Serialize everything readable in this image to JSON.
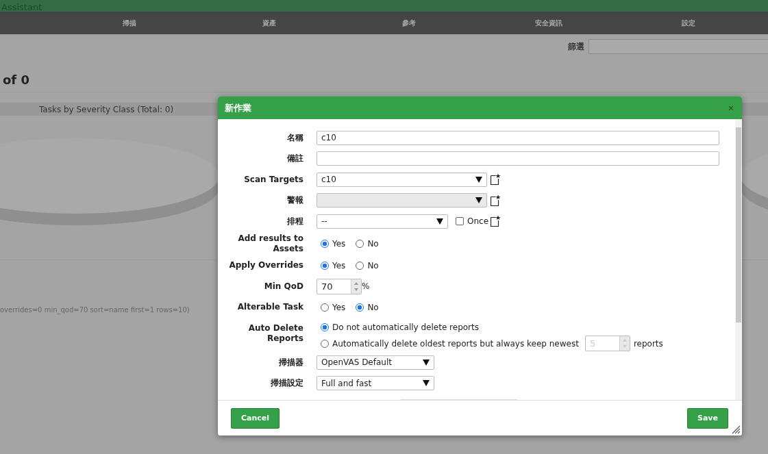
{
  "app": {
    "title": "Assistant"
  },
  "nav": [
    "掃描",
    "資產",
    "參考",
    "安全資訊",
    "設定"
  ],
  "filter": {
    "label": "篩選"
  },
  "page": {
    "heading": "of 0",
    "chart_title": "Tasks by Severity Class (Total: 0)",
    "filter_text": "overrides=0 min_qod=70 sort=name first=1 rows=10)"
  },
  "dialog": {
    "title": "新作業",
    "close": "×",
    "fields": [
      {
        "kind": "text",
        "label": "名稱",
        "value": "c10"
      },
      {
        "kind": "text",
        "label": "備註"
      },
      {
        "kind": "select-long",
        "label": "Scan Targets",
        "value": "c10",
        "disabled": false
      },
      {
        "kind": "select-long",
        "label": "警報",
        "disabled": true
      },
      {
        "kind": "schedule",
        "label": "排程",
        "value": "--",
        "once": {
          "label": "Once",
          "checked": false
        }
      },
      {
        "kind": "radio",
        "label": "Add results to Assets",
        "options": [
          {
            "label": "Yes",
            "selected": true
          },
          {
            "label": "No",
            "selected": false
          }
        ]
      },
      {
        "kind": "radio",
        "label": "Apply Overrides",
        "options": [
          {
            "label": "Yes",
            "selected": true
          },
          {
            "label": "No",
            "selected": false
          }
        ]
      },
      {
        "kind": "spin",
        "label": "Min QoD",
        "value": "70",
        "unit": "%"
      },
      {
        "kind": "radio",
        "label": "Alterable Task",
        "options": [
          {
            "label": "Yes",
            "selected": false
          },
          {
            "label": "No",
            "selected": true
          }
        ]
      },
      {
        "kind": "autodelete",
        "label": "Auto Delete Reports",
        "options": [
          {
            "label": "Do not automatically delete reports",
            "selected": true
          },
          {
            "label": "Automatically delete oldest reports but always keep newest",
            "selected": false,
            "value": "5",
            "value_disabled": true,
            "suffix": "reports"
          }
        ]
      },
      {
        "kind": "select-short",
        "label": "掃描器",
        "value": "OpenVAS Default",
        "disabled": false
      },
      {
        "kind": "select-short",
        "label": "掃描設定",
        "value": "Full and fast",
        "disabled": false
      }
    ],
    "buttons": [
      {
        "label": "Cancel"
      },
      {
        "label": "Save"
      }
    ]
  }
}
